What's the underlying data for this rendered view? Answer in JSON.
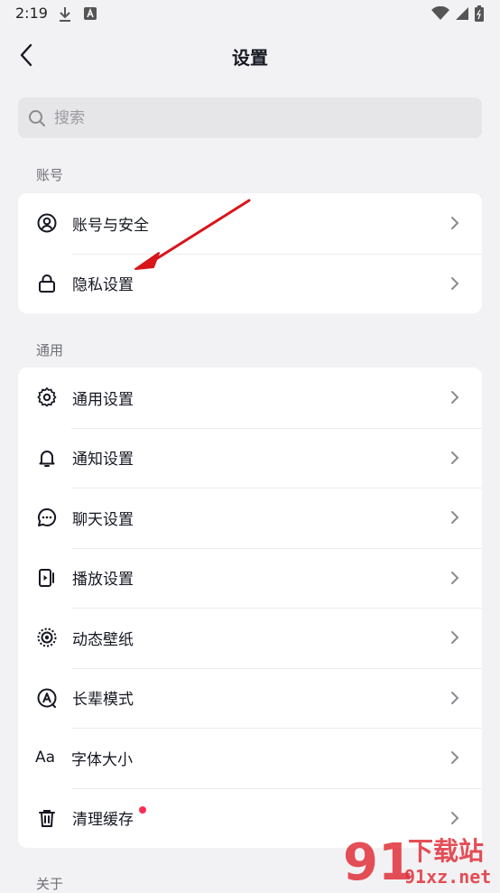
{
  "status_bar": {
    "time": "2:19"
  },
  "header": {
    "title": "设置"
  },
  "search": {
    "placeholder": "搜索"
  },
  "sections": {
    "account": {
      "label": "账号",
      "items": [
        {
          "label": "账号与安全",
          "icon": "user-circle-icon"
        },
        {
          "label": "隐私设置",
          "icon": "lock-icon"
        }
      ]
    },
    "general": {
      "label": "通用",
      "items": [
        {
          "label": "通用设置",
          "icon": "gear-icon"
        },
        {
          "label": "通知设置",
          "icon": "bell-icon"
        },
        {
          "label": "聊天设置",
          "icon": "chat-bubble-icon"
        },
        {
          "label": "播放设置",
          "icon": "play-icon"
        },
        {
          "label": "动态壁纸",
          "icon": "wallpaper-icon"
        },
        {
          "label": "长辈模式",
          "icon": "elder-mode-icon"
        },
        {
          "label": "字体大小",
          "icon": "font-size-icon",
          "glyph": "Aa"
        },
        {
          "label": "清理缓存",
          "icon": "trash-icon",
          "badge": "red-dot"
        }
      ]
    },
    "about": {
      "label": "关于"
    }
  },
  "watermark": {
    "text_cn": "下载站",
    "text_en": "91xz.net"
  },
  "colors": {
    "background": "#f2f2f4",
    "card": "#ffffff",
    "accent_red": "#fe2c55",
    "annotation_arrow": "#d9141b"
  }
}
